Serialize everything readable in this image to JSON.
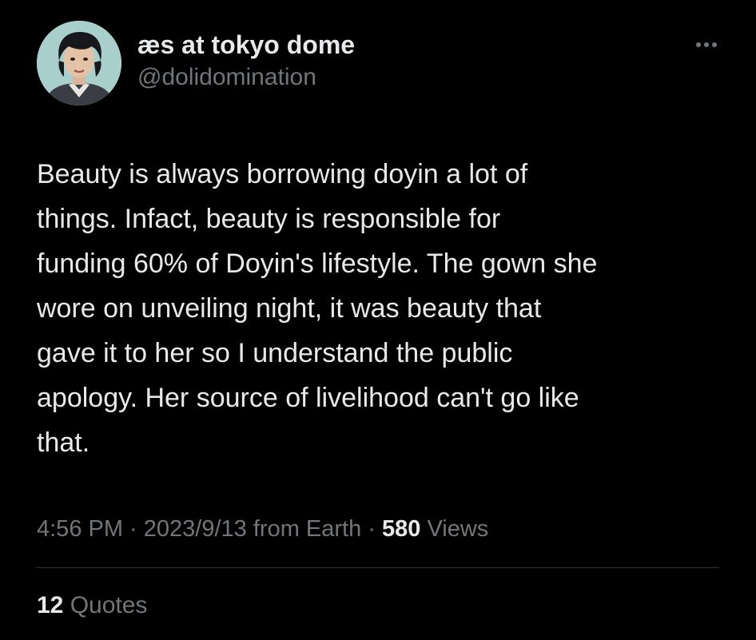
{
  "user": {
    "display_name": "æs at tokyo dome",
    "handle": "@dolidomination",
    "avatar_icon": "user-avatar-photo"
  },
  "tweet": {
    "lines": [
      "Beauty is always borrowing doyin a lot of",
      "things. Infact, beauty is responsible for",
      "funding 60% of Doyin's lifestyle. The gown she",
      "wore on unveiling night, it was beauty that",
      "gave it to her so I understand the public",
      "apology. Her source of livelihood can't go like",
      "that."
    ]
  },
  "meta": {
    "time": "4:56 PM",
    "separator": " · ",
    "date": "2023/9/13",
    "source": " from Earth",
    "views_count": "580",
    "views_label": " Views"
  },
  "stats": {
    "quotes_count": "12",
    "quotes_label": " Quotes"
  },
  "colors": {
    "background": "#000000",
    "primary_text": "#e7e9ea",
    "secondary_text": "#71767b",
    "divider": "#2f3336"
  }
}
